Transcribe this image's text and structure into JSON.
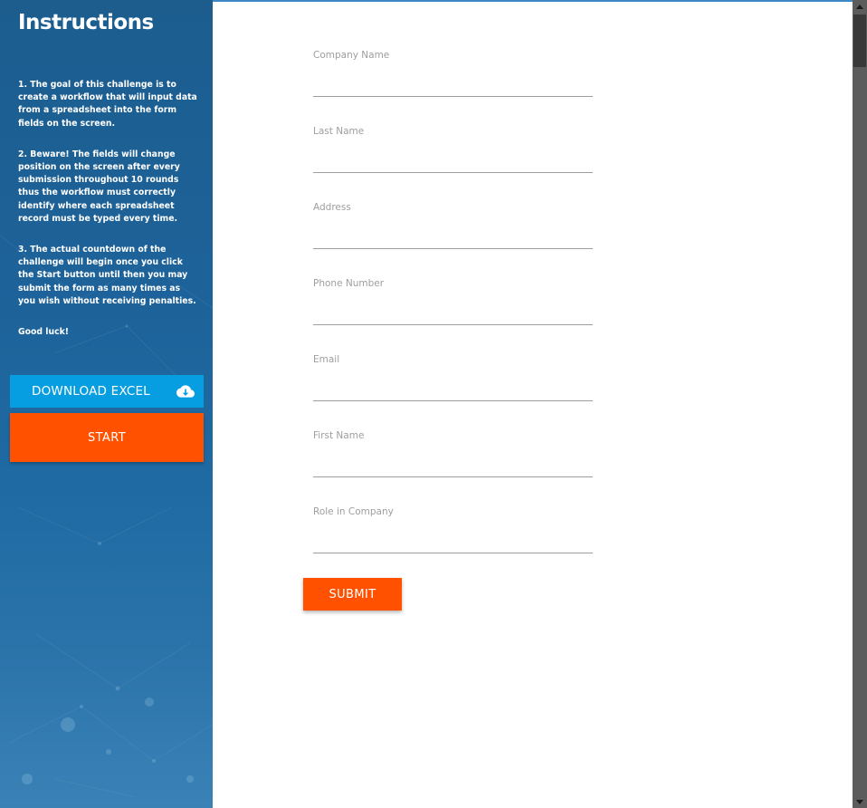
{
  "sidebar": {
    "title": "Instructions",
    "paragraphs": [
      "1. The goal of this challenge is to create a workflow that will input data from a spreadsheet into the form fields on the screen.",
      "2. Beware! The fields will change position on the screen after every submission throughout 10 rounds thus the workflow must correctly identify where each spreadsheet record must be typed every time.",
      "3. The actual countdown of the challenge will begin once you click the Start button until then you may submit the form as many times as you wish without receiving penalties.",
      "Good luck!"
    ],
    "download_label": "DOWNLOAD EXCEL",
    "download_icon": "cloud-download-icon",
    "start_label": "START"
  },
  "form": {
    "fields": [
      {
        "label": "Company Name",
        "value": ""
      },
      {
        "label": "Last Name",
        "value": ""
      },
      {
        "label": "Address",
        "value": ""
      },
      {
        "label": "Phone Number",
        "value": ""
      },
      {
        "label": "Email",
        "value": ""
      },
      {
        "label": "First Name",
        "value": ""
      },
      {
        "label": "Role in Company",
        "value": ""
      }
    ],
    "submit_label": "SUBMIT"
  },
  "colors": {
    "sidebar_bg": "#1d6299",
    "download_button": "#069ee0",
    "start_button": "#ff5100",
    "submit_button": "#ff5100",
    "field_label": "#9e9e9e"
  }
}
